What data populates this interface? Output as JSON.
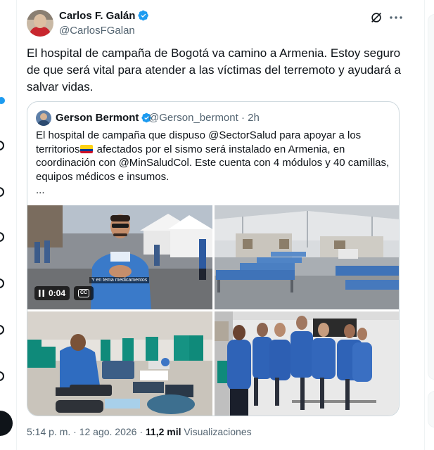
{
  "tweet": {
    "author_name": "Carlos F. Galán",
    "author_handle": "@CarlosFGalan",
    "text": "El hospital de campaña de Bogotá va camino a Armenia. Estoy seguro de que será vital para atender a las víctimas del terremoto y ayudará a salvar vidas.",
    "timestamp": "5:14 p. m. · 12 ago. 2026 · ",
    "views_count": "11,2 mil",
    "views_label": " Visualizaciones"
  },
  "quote": {
    "author_name": "Gerson Bermont",
    "author_handle": "@Gerson_bermont",
    "time": " · 2h",
    "text_before_flag": "El hospital de campaña que dispuso @SectorSalud para apoyar a los territorios",
    "text_after_flag": " afectados por el sismo será instalado en Armenia, en coordinación con @MinSaludCol. Este cuenta con 4 módulos y 40 camillas, equipos médicos e insumos.",
    "ellipsis": "...",
    "video": {
      "duration": "0:04",
      "cc_label": "CC",
      "caption": "Y en tema medicamentos"
    }
  },
  "colors": {
    "verified": "#1d9bf0",
    "text_primary": "#0f1419",
    "text_secondary": "#536471",
    "border": "#cfd9de"
  },
  "icons": [
    "verified-badge-icon",
    "grok-icon",
    "more-icon",
    "pause-icon",
    "cc-icon",
    "flag-colombia-icon"
  ]
}
